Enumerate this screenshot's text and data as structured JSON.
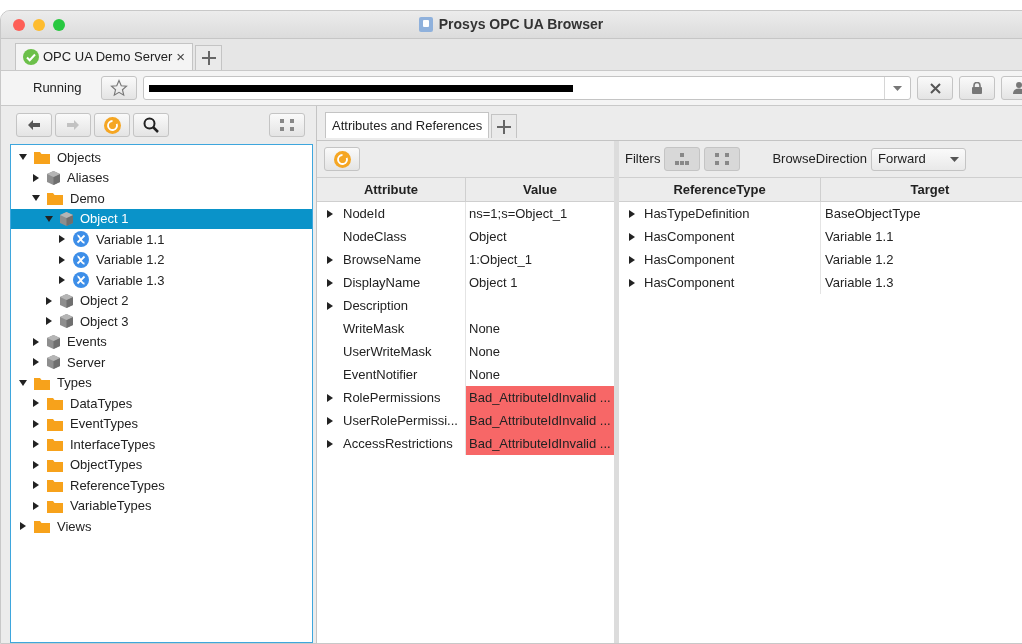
{
  "window": {
    "title": "Prosys OPC UA Browser"
  },
  "tabs": [
    {
      "label": "OPC UA Demo Server",
      "close": "×",
      "selected": true
    }
  ],
  "connection": {
    "status": "Running"
  },
  "tree": [
    {
      "label": "Objects",
      "kind": "folder",
      "expanded": true,
      "selected": false,
      "children": [
        {
          "label": "Aliases",
          "kind": "object",
          "expanded": false,
          "selected": false
        },
        {
          "label": "Demo",
          "kind": "folder",
          "expanded": true,
          "selected": false,
          "children": [
            {
              "label": "Object 1",
              "kind": "object",
              "expanded": true,
              "selected": true,
              "children": [
                {
                  "label": "Variable 1.1",
                  "kind": "variable",
                  "expanded": false,
                  "selected": false
                },
                {
                  "label": "Variable 1.2",
                  "kind": "variable",
                  "expanded": false,
                  "selected": false
                },
                {
                  "label": "Variable 1.3",
                  "kind": "variable",
                  "expanded": false,
                  "selected": false
                }
              ]
            },
            {
              "label": "Object 2",
              "kind": "object",
              "expanded": false,
              "selected": false
            },
            {
              "label": "Object 3",
              "kind": "object",
              "expanded": false,
              "selected": false
            }
          ]
        },
        {
          "label": "Events",
          "kind": "object",
          "expanded": false,
          "selected": false
        },
        {
          "label": "Server",
          "kind": "object",
          "expanded": false,
          "selected": false
        }
      ]
    },
    {
      "label": "Types",
      "kind": "folder",
      "expanded": true,
      "selected": false,
      "children": [
        {
          "label": "DataTypes",
          "kind": "folder",
          "expanded": false,
          "selected": false
        },
        {
          "label": "EventTypes",
          "kind": "folder",
          "expanded": false,
          "selected": false
        },
        {
          "label": "InterfaceTypes",
          "kind": "folder",
          "expanded": false,
          "selected": false
        },
        {
          "label": "ObjectTypes",
          "kind": "folder",
          "expanded": false,
          "selected": false
        },
        {
          "label": "ReferenceTypes",
          "kind": "folder",
          "expanded": false,
          "selected": false
        },
        {
          "label": "VariableTypes",
          "kind": "folder",
          "expanded": false,
          "selected": false
        }
      ]
    },
    {
      "label": "Views",
      "kind": "folder",
      "expanded": false,
      "selected": false
    }
  ],
  "view_tabs": [
    {
      "label": "Attributes and References",
      "selected": true
    }
  ],
  "attributes": {
    "columns": [
      "Attribute",
      "Value"
    ],
    "rows": [
      {
        "attribute": "NodeId",
        "value": "ns=1;s=Object_1",
        "expandable": true,
        "error": false
      },
      {
        "attribute": "NodeClass",
        "value": "Object",
        "expandable": false,
        "error": false
      },
      {
        "attribute": "BrowseName",
        "value": "1:Object_1",
        "expandable": true,
        "error": false
      },
      {
        "attribute": "DisplayName",
        "value": "Object 1",
        "expandable": true,
        "error": false
      },
      {
        "attribute": "Description",
        "expandable": true,
        "error": false
      },
      {
        "attribute": "WriteMask",
        "value": "None",
        "expandable": false,
        "error": false
      },
      {
        "attribute": "UserWriteMask",
        "value": "None",
        "expandable": false,
        "error": false
      },
      {
        "attribute": "EventNotifier",
        "value": "None",
        "expandable": false,
        "error": false
      },
      {
        "attribute": "RolePermissions",
        "value": "Bad_AttributeIdInvalid ...",
        "expandable": true,
        "error": true
      },
      {
        "attribute": "UserRolePermissi...",
        "value": "Bad_AttributeIdInvalid ...",
        "expandable": true,
        "error": true
      },
      {
        "attribute": "AccessRestrictions",
        "value": "Bad_AttributeIdInvalid ...",
        "expandable": true,
        "error": true
      }
    ]
  },
  "references": {
    "filters_label": "Filters",
    "direction_label": "BrowseDirection",
    "direction": "Forward",
    "columns": [
      "ReferenceType",
      "Target"
    ],
    "rows": [
      {
        "type": "HasTypeDefinition",
        "target": "BaseObjectType"
      },
      {
        "type": "HasComponent",
        "target": "Variable 1.1"
      },
      {
        "type": "HasComponent",
        "target": "Variable 1.2"
      },
      {
        "type": "HasComponent",
        "target": "Variable 1.3"
      }
    ]
  }
}
